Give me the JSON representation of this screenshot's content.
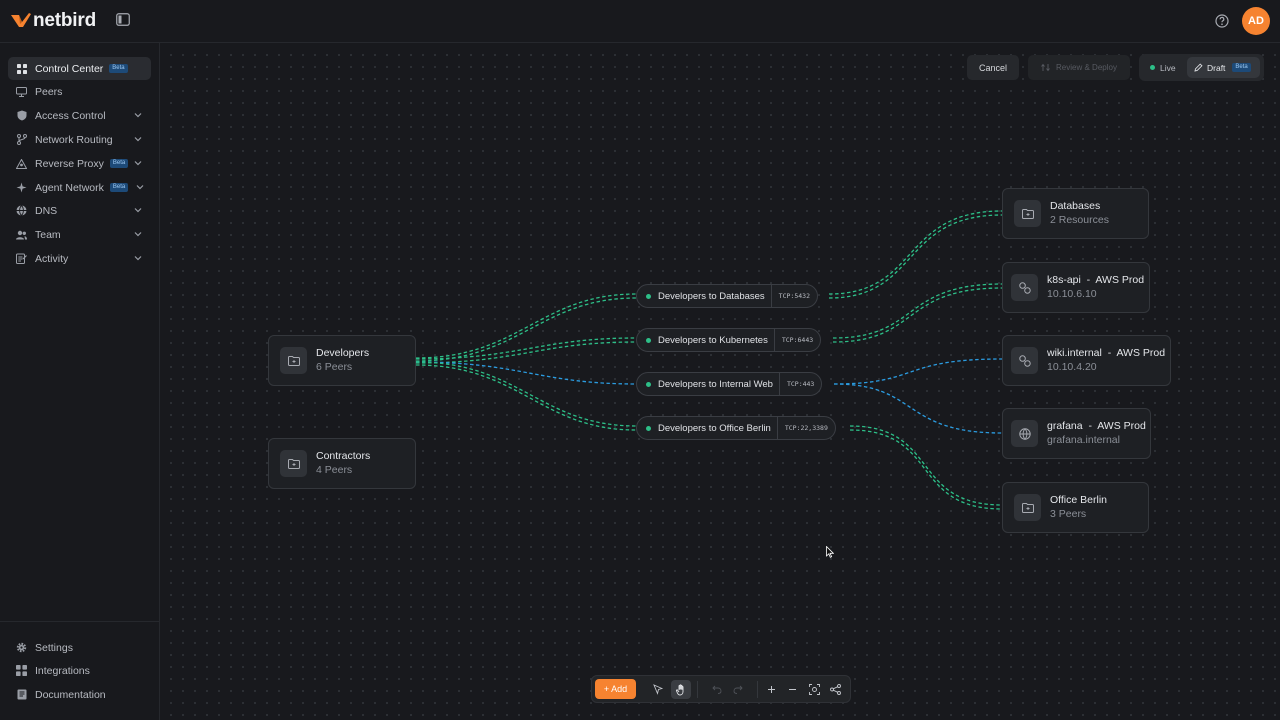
{
  "app": {
    "name": "netbird",
    "user_initials": "AD",
    "brand_color": "#f68330"
  },
  "sidebar": {
    "items": [
      {
        "label": "Control Center",
        "badge": "Beta",
        "icon": "grid-icon",
        "active": true
      },
      {
        "label": "Peers",
        "icon": "monitor-icon"
      },
      {
        "label": "Access Control",
        "icon": "shield-icon",
        "expandable": true
      },
      {
        "label": "Network Routing",
        "icon": "route-icon",
        "expandable": true
      },
      {
        "label": "Reverse Proxy",
        "badge": "Beta",
        "icon": "proxy-icon",
        "expandable": true
      },
      {
        "label": "Agent Network",
        "badge": "Beta",
        "icon": "sparkle-icon",
        "expandable": true
      },
      {
        "label": "DNS",
        "icon": "globe-icon",
        "expandable": true
      },
      {
        "label": "Team",
        "icon": "users-icon",
        "expandable": true
      },
      {
        "label": "Activity",
        "icon": "activity-icon",
        "expandable": true
      }
    ],
    "bottom": [
      {
        "label": "Settings",
        "icon": "gear-icon"
      },
      {
        "label": "Integrations",
        "icon": "integrations-icon"
      },
      {
        "label": "Documentation",
        "icon": "book-icon"
      }
    ]
  },
  "header_actions": {
    "cancel": "Cancel",
    "review_deploy": "Review & Deploy",
    "live": "Live",
    "draft": "Draft",
    "draft_badge": "Beta"
  },
  "groups": [
    {
      "title": "Developers",
      "subtitle": "6 Peers"
    },
    {
      "title": "Contractors",
      "subtitle": "4 Peers"
    }
  ],
  "policies": [
    {
      "label": "Developers to Databases",
      "port": "TCP:5432"
    },
    {
      "label": "Developers to Kubernetes",
      "port": "TCP:6443"
    },
    {
      "label": "Developers to Internal Web",
      "port": "TCP:443"
    },
    {
      "label": "Developers to Office Berlin",
      "port": "TCP:22,3389"
    }
  ],
  "destinations": [
    {
      "title": "Databases",
      "subtitle": "2 Resources",
      "icon": "folder-network-icon"
    },
    {
      "title": "k8s-api  -  AWS Prod",
      "subtitle": "10.10.6.10",
      "icon": "link-icon"
    },
    {
      "title": "wiki.internal  -  AWS Prod",
      "subtitle": "10.10.4.20",
      "icon": "link-icon"
    },
    {
      "title": "grafana  -  AWS Prod",
      "subtitle": "grafana.internal",
      "icon": "globe-icon"
    },
    {
      "title": "Office Berlin",
      "subtitle": "3 Peers",
      "icon": "folder-network-icon"
    }
  ],
  "toolbar": {
    "add": "+ Add"
  },
  "colors": {
    "edge_green": "#2dbf88",
    "edge_blue": "#2b9ce0"
  }
}
